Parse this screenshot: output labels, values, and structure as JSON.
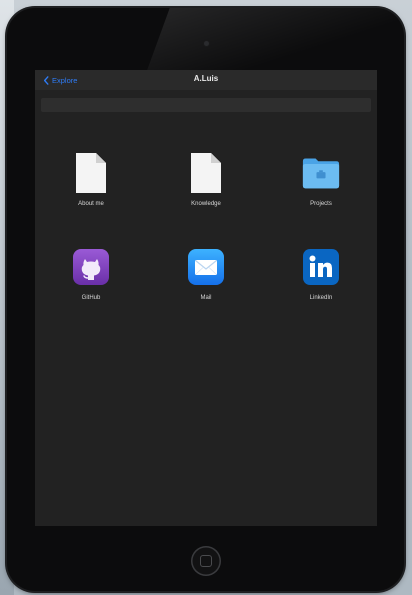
{
  "nav": {
    "back_label": "Explore",
    "title": "A.Luis"
  },
  "items": [
    {
      "label": "About me",
      "icon": "document-icon"
    },
    {
      "label": "Knowledge",
      "icon": "document-icon"
    },
    {
      "label": "Projects",
      "icon": "folder-icon"
    },
    {
      "label": "GitHub",
      "icon": "github-icon"
    },
    {
      "label": "Mail",
      "icon": "mail-icon"
    },
    {
      "label": "LinkedIn",
      "icon": "linkedin-icon"
    }
  ],
  "colors": {
    "accent": "#2f7cf6",
    "screen_background": "#222222",
    "folder": "#5fb2ef",
    "github": "#7a3fb5",
    "mail": "#1e8cf5",
    "linkedin": "#0a66c2"
  }
}
